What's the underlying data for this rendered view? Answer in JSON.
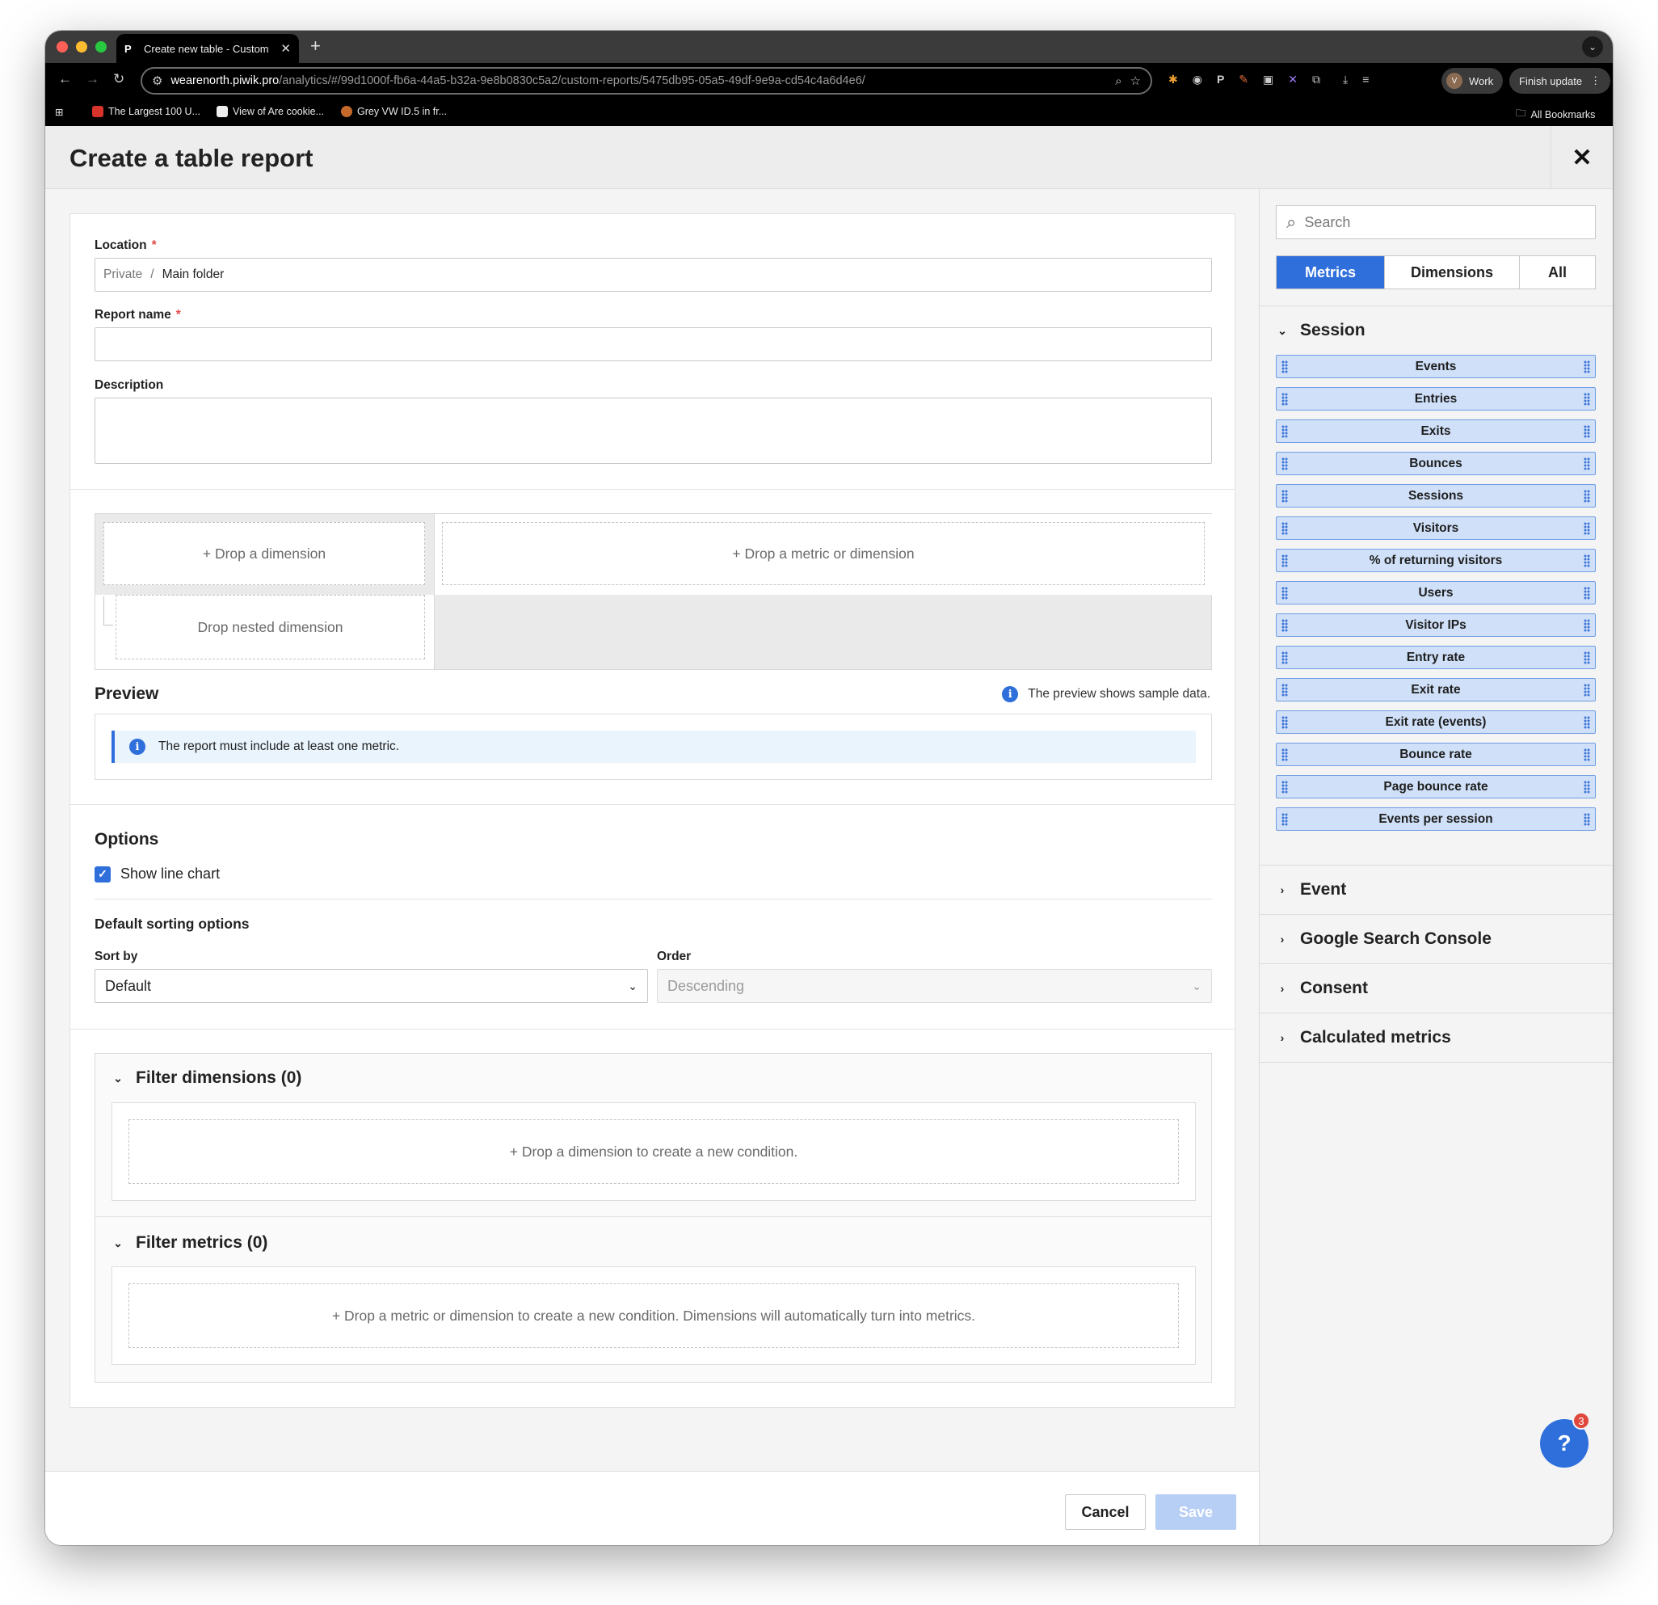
{
  "browser": {
    "tab_title": "Create new table - Custom re",
    "tab_favicon": "P",
    "url_host": "wearenorth.piwik.pro",
    "url_path": "/analytics/#/99d1000f-fb6a-44a5-b32a-9e8b0830c5a2/custom-reports/5475db95-05a5-49df-9e9a-cd54c4a6d4e6/",
    "profile_initial": "V",
    "profile_label": "Work",
    "finish_update": "Finish update",
    "bookmarks": [
      "The Largest 100 U...",
      "View of Are cookie...",
      "Grey VW ID.5 in fr..."
    ],
    "all_bookmarks": "All Bookmarks"
  },
  "header": {
    "title": "Create a table report"
  },
  "form": {
    "location_label": "Location",
    "location_root": "Private",
    "location_sep": "/",
    "location_folder": "Main folder",
    "report_name_label": "Report name",
    "report_name_value": "",
    "description_label": "Description",
    "description_value": "",
    "required_mark": "*"
  },
  "builder": {
    "drop_dimension": "+ Drop a dimension",
    "drop_metric_or_dimension": "+ Drop a metric or dimension",
    "drop_nested": "Drop nested dimension"
  },
  "preview": {
    "title": "Preview",
    "note": "The preview shows sample data.",
    "alert": "The report must include at least one metric."
  },
  "options": {
    "title": "Options",
    "show_line_chart_label": "Show line chart",
    "show_line_chart_checked": true,
    "sorting_title": "Default sorting options",
    "sort_by_label": "Sort by",
    "sort_by_value": "Default",
    "order_label": "Order",
    "order_value": "Descending"
  },
  "filters": {
    "dimensions_title": "Filter dimensions (0)",
    "dimensions_drop": "+ Drop a dimension to create a new condition.",
    "metrics_title": "Filter metrics (0)",
    "metrics_drop": "+ Drop a metric or dimension to create a new condition. Dimensions will automatically turn into metrics."
  },
  "footer": {
    "cancel": "Cancel",
    "save": "Save"
  },
  "sidebar": {
    "search_placeholder": "Search",
    "tabs": [
      "Metrics",
      "Dimensions",
      "All"
    ],
    "active_tab": "Metrics",
    "session_group": "Session",
    "session_items": [
      "Events",
      "Entries",
      "Exits",
      "Bounces",
      "Sessions",
      "Visitors",
      "% of returning visitors",
      "Users",
      "Visitor IPs",
      "Entry rate",
      "Exit rate",
      "Exit rate (events)",
      "Bounce rate",
      "Page bounce rate",
      "Events per session"
    ],
    "collapsed_groups": [
      "Event",
      "Google Search Console",
      "Consent",
      "Calculated metrics"
    ]
  },
  "help": {
    "label": "?",
    "badge": "3"
  },
  "colors": {
    "accent": "#2f6fdc",
    "pill_bg": "#cfe0f8",
    "danger": "#e0473d"
  }
}
